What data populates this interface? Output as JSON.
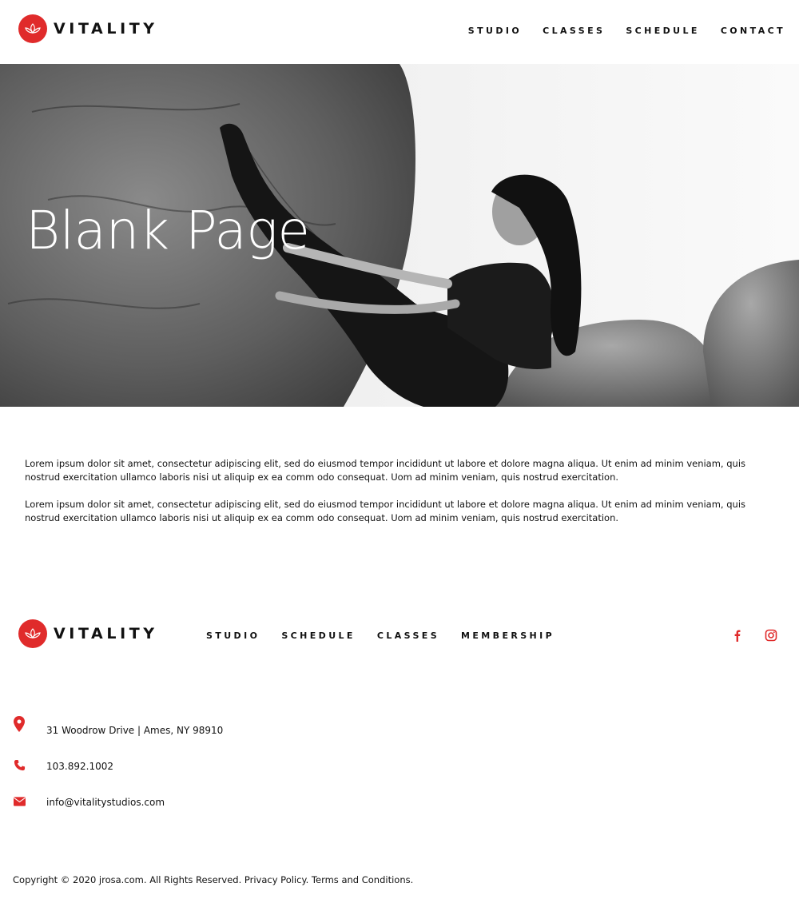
{
  "brand": {
    "name": "VITALITY",
    "accent_color": "#e02b2b",
    "logo_icon": "lotus-icon"
  },
  "header_nav": [
    "STUDIO",
    "CLASSES",
    "SCHEDULE",
    "CONTACT"
  ],
  "hero": {
    "title": "Blank Page"
  },
  "content": {
    "paragraphs": [
      "Lorem ipsum dolor sit amet, consectetur adipiscing elit, sed do eiusmod tempor incididunt ut labore et dolore magna aliqua. Ut enim ad minim veniam, quis nostrud exercitation ullamco laboris nisi ut aliquip ex ea comm odo consequat. Uom ad minim veniam, quis nostrud exercitation.",
      "Lorem ipsum dolor sit amet, consectetur adipiscing elit, sed do eiusmod tempor incididunt ut labore et dolore magna aliqua. Ut enim ad minim veniam, quis nostrud exercitation ullamco laboris nisi ut aliquip ex ea comm odo consequat. Uom ad minim veniam, quis nostrud exercitation."
    ]
  },
  "footer_nav": [
    "STUDIO",
    "SCHEDULE",
    "CLASSES",
    "MEMBERSHIP"
  ],
  "social": [
    "facebook-icon",
    "instagram-icon"
  ],
  "contact": {
    "address": "31 Woodrow Drive | Ames, NY 98910",
    "phone": "103.892.1002",
    "email": "info@vitalitystudios.com"
  },
  "copyright": "Copyright © 2020 jrosa.com. All Rights Reserved. Privacy Policy. Terms and Conditions."
}
